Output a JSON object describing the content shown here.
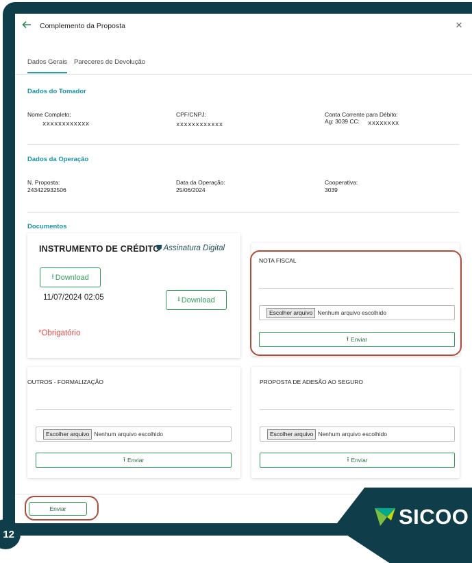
{
  "dialog": {
    "title": "Complemento da Proposta",
    "close_symbol": "×"
  },
  "tabs": [
    {
      "label": "Dados Gerais",
      "active": true
    },
    {
      "label": "Pareceres de Devolução",
      "active": false
    }
  ],
  "tomador": {
    "section_title": "Dados do Tomador",
    "nome_label": "Nome Completo:",
    "nome_value": "xxxxxxxxxxxx",
    "cpf_label": "CPF/CNPJ:",
    "cpf_value": "xxxxxxxxxxxx",
    "conta_label": "Conta Corrente para Débito:",
    "conta_prefix": "Ag: 3039 CC:",
    "conta_value": "xxxxxxxx"
  },
  "operacao": {
    "section_title": "Dados da Operação",
    "proposta_label": "N. Proposta:",
    "proposta_value": "243422932506",
    "data_label": "Data da Operação:",
    "data_value": "25/06/2024",
    "coop_label": "Cooperativa:",
    "coop_value": "3039"
  },
  "documentos": {
    "section_title": "Documentos",
    "instrumento": {
      "title": "INSTRUMENTO DE CRÉDITO",
      "signature_label": "Assinatura Digital",
      "download_label": "Download",
      "download_date": "11/07/2024 02:05",
      "download_label_2": "Download",
      "required_label": "*Obrigatório"
    },
    "nota_fiscal": {
      "title": "NOTA FISCAL",
      "file_button": "Escolher arquivo",
      "file_status": "Nenhum arquivo escolhido",
      "send_label": "Enviar"
    },
    "outros": {
      "title": "OUTROS - FORMALIZAÇÃO",
      "file_button": "Escolher arquivo",
      "file_status": "Nenhum arquivo escolhido",
      "send_label": "Enviar"
    },
    "seguro": {
      "title": "PROPOSTA DE ADESÃO AO SEGURO",
      "file_button": "Escolher arquivo",
      "file_status": "Nenhum arquivo escolhido",
      "send_label": "Enviar"
    }
  },
  "footer": {
    "send_label": "Enviar"
  },
  "brand": {
    "name": "SICOO",
    "colors": {
      "dark": "#0f3d49",
      "green": "#2e9c58",
      "teal": "#1a93a7",
      "highlight": "#b04a3a"
    }
  },
  "page_badge": "12",
  "icons": {
    "back": "arrow-left-icon",
    "close": "close-icon",
    "shield": "shield-icon",
    "download": "download-icon",
    "upload": "upload-icon",
    "logo": "sicoob-logo-icon"
  }
}
